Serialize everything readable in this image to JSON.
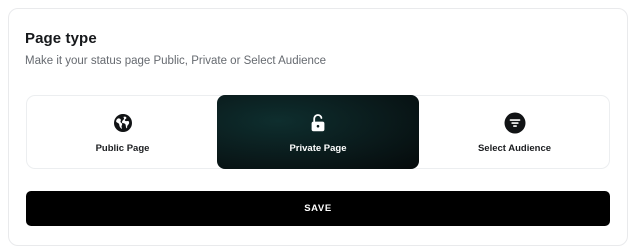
{
  "section": {
    "title": "Page type",
    "subtitle": "Make it your status page Public, Private or Select Audience"
  },
  "options": [
    {
      "label": "Public Page",
      "icon": "globe-icon",
      "selected": false
    },
    {
      "label": "Private Page",
      "icon": "unlock-icon",
      "selected": true
    },
    {
      "label": "Select Audience",
      "icon": "filter-icon",
      "selected": false
    }
  ],
  "actions": {
    "save_label": "SAVE"
  },
  "colors": {
    "selected_bg": "#0a1a1b",
    "button_bg": "#000000",
    "text_primary": "#16181b",
    "text_secondary": "#666a70"
  }
}
